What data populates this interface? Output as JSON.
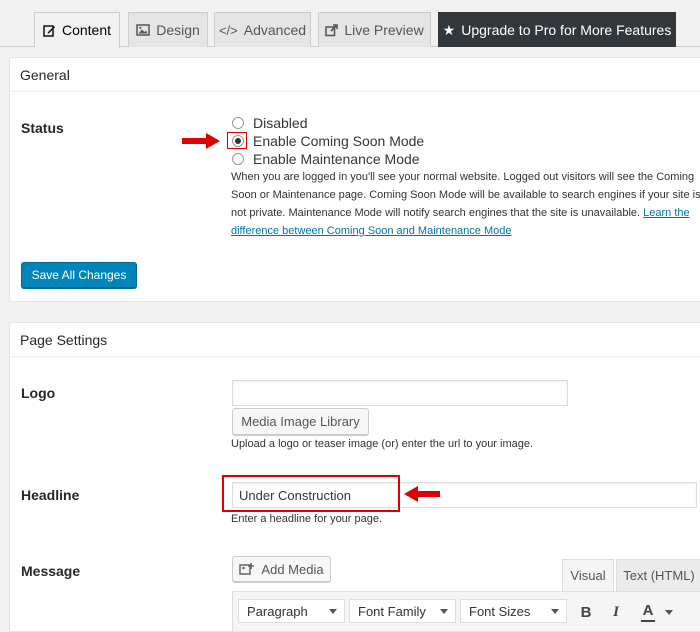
{
  "tabs": [
    {
      "label": "Content",
      "icon": "edit-icon"
    },
    {
      "label": "Design",
      "icon": "image-icon"
    },
    {
      "label": "Advanced",
      "icon": "code-icon"
    },
    {
      "label": "Live Preview",
      "icon": "external-link-icon"
    },
    {
      "label": "Upgrade to Pro for More Features",
      "icon": "star-icon"
    }
  ],
  "general": {
    "title": "General",
    "status_label": "Status",
    "options": [
      "Disabled",
      "Enable Coming Soon Mode",
      "Enable Maintenance Mode"
    ],
    "selected_option": "Enable Coming Soon Mode",
    "description": "When you are logged in you'll see your normal website. Logged out visitors will see the Coming Soon or Maintenance page. Coming Soon Mode will be available to search engines if your site is not private. Maintenance Mode will notify search engines that the site is unavailable.",
    "description_link": "Learn the difference between Coming Soon and Maintenance Mode",
    "save_label": "Save All Changes"
  },
  "page_settings": {
    "title": "Page Settings",
    "logo_label": "Logo",
    "logo_value": "",
    "media_button": "Media Image Library",
    "logo_hint": "Upload a logo or teaser image (or) enter the url to your image.",
    "headline_label": "Headline",
    "headline_value": "Under Construction",
    "headline_hint": "Enter a headline for your page.",
    "message_label": "Message",
    "add_media": "Add Media",
    "editor_tabs": [
      "Visual",
      "Text (HTML)"
    ],
    "toolbar": {
      "format": "Paragraph",
      "font_family": "Font Family",
      "font_size": "Font Sizes",
      "bold": "B",
      "italic": "I",
      "text_color": "A"
    }
  },
  "colors": {
    "primary": "#0085ba",
    "pro_tab": "#32373c",
    "annotation": "#dd0000",
    "link": "#0073aa"
  }
}
